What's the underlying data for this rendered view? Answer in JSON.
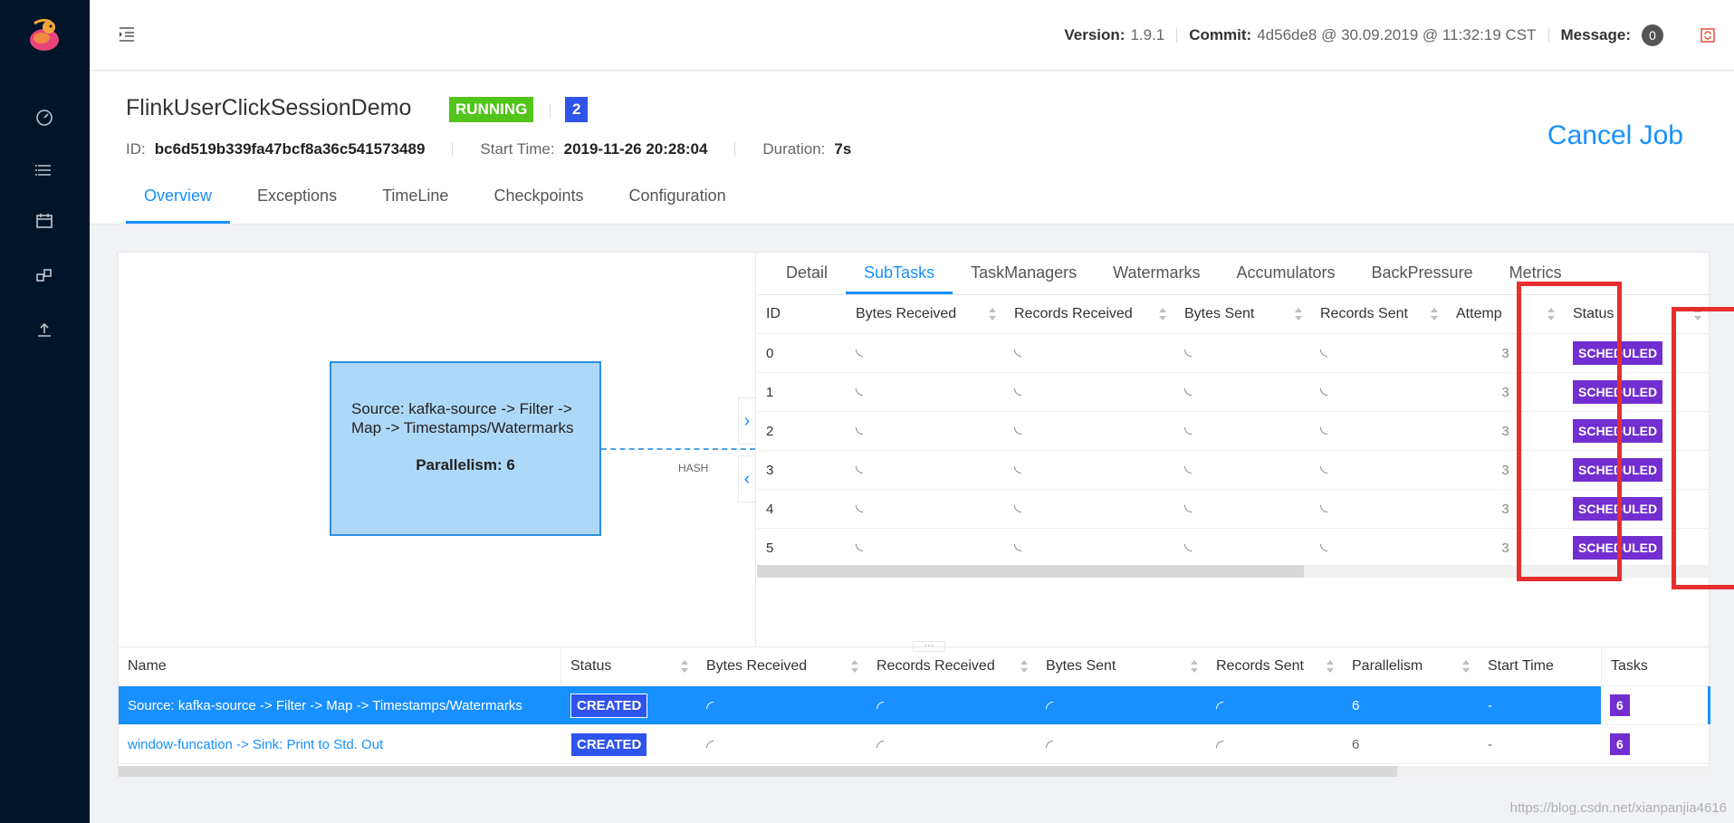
{
  "header": {
    "version_label": "Version:",
    "version_value": "1.9.1",
    "commit_label": "Commit:",
    "commit_value": "4d56de8 @ 30.09.2019 @ 11:32:19 CST",
    "message_label": "Message:",
    "message_count": "0"
  },
  "job": {
    "name": "FlinkUserClickSessionDemo",
    "status": "RUNNING",
    "count": "2",
    "id_label": "ID:",
    "id_value": "bc6d519b339fa47bcf8a36c541573489",
    "start_label": "Start Time:",
    "start_value": "2019-11-26 20:28:04",
    "duration_label": "Duration:",
    "duration_value": "7s",
    "cancel_label": "Cancel Job",
    "tabs": [
      "Overview",
      "Exceptions",
      "TimeLine",
      "Checkpoints",
      "Configuration"
    ]
  },
  "graph": {
    "node_text": "Source: kafka-source -> Filter -> Map -> Timestamps/Watermarks",
    "node_parallelism": "Parallelism: 6",
    "edge_label": "HASH"
  },
  "subtasks": {
    "tabs": [
      "Detail",
      "SubTasks",
      "TaskManagers",
      "Watermarks",
      "Accumulators",
      "BackPressure",
      "Metrics"
    ],
    "columns": [
      "ID",
      "Bytes Received",
      "Records Received",
      "Bytes Sent",
      "Records Sent",
      "Attemp",
      "Status"
    ],
    "rows": [
      {
        "id": "0",
        "attempt": "3",
        "status": "SCHEDULED"
      },
      {
        "id": "1",
        "attempt": "3",
        "status": "SCHEDULED"
      },
      {
        "id": "2",
        "attempt": "3",
        "status": "SCHEDULED"
      },
      {
        "id": "3",
        "attempt": "3",
        "status": "SCHEDULED"
      },
      {
        "id": "4",
        "attempt": "3",
        "status": "SCHEDULED"
      },
      {
        "id": "5",
        "attempt": "3",
        "status": "SCHEDULED"
      }
    ]
  },
  "vertices": {
    "columns": [
      "Name",
      "Status",
      "Bytes Received",
      "Records Received",
      "Bytes Sent",
      "Records Sent",
      "Parallelism",
      "Start Time",
      "Tasks"
    ],
    "rows": [
      {
        "name": "Source: kafka-source -> Filter -> Map -> Timestamps/Watermarks",
        "status": "CREATED",
        "parallelism": "6",
        "start": "-",
        "tasks": "6"
      },
      {
        "name": "window-funcation -> Sink: Print to Std. Out",
        "status": "CREATED",
        "parallelism": "6",
        "start": "-",
        "tasks": "6"
      }
    ]
  },
  "watermark": "https://blog.csdn.net/xianpanjia4616",
  "colors": {
    "accent": "#1890ff",
    "running": "#52c41a",
    "scheduled": "#722ed1",
    "created": "#2f54eb",
    "highlight": "#e62e2e"
  }
}
